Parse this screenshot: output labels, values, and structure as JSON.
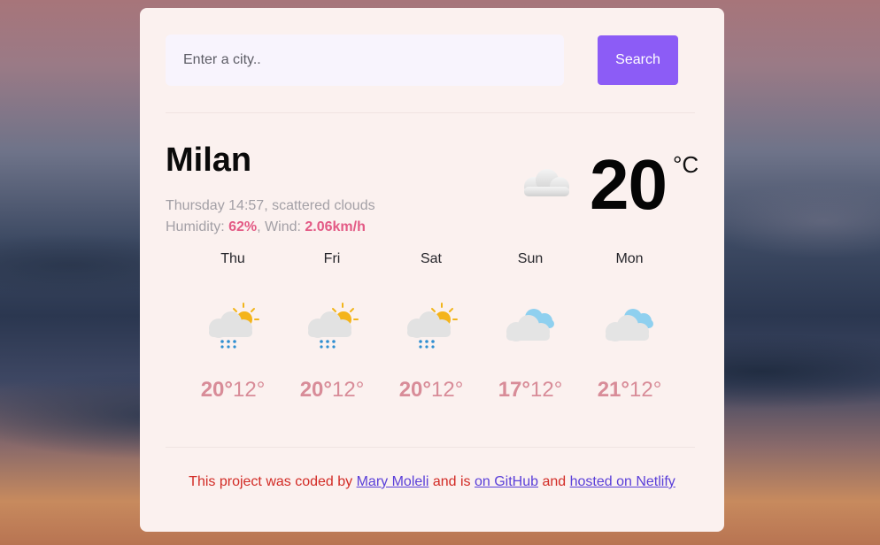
{
  "search": {
    "placeholder": "Enter a city..",
    "button_label": "Search"
  },
  "current": {
    "city": "Milan",
    "datetime": "Thursday 14:57",
    "description": "scattered clouds",
    "humidity_label": "Humidity: ",
    "humidity_value": "62%",
    "wind_label": ", Wind: ",
    "wind_value": "2.06km/h",
    "temperature": "20",
    "unit": "°C",
    "icon": "cloud-icon"
  },
  "forecast": [
    {
      "day": "Thu",
      "max": "20°",
      "min": "12°",
      "icon": "rain-sun-icon"
    },
    {
      "day": "Fri",
      "max": "20°",
      "min": "12°",
      "icon": "rain-sun-icon"
    },
    {
      "day": "Sat",
      "max": "20°",
      "min": "12°",
      "icon": "rain-sun-icon"
    },
    {
      "day": "Sun",
      "max": "17°",
      "min": "12°",
      "icon": "clouds-icon"
    },
    {
      "day": "Mon",
      "max": "21°",
      "min": "12°",
      "icon": "clouds-icon"
    }
  ],
  "footer": {
    "text_1": "This project was coded by ",
    "author_link": "Mary Moleli",
    "text_2": " and is ",
    "github_link": "on GitHub",
    "text_3": " and ",
    "netlify_link": "hosted on Netlify"
  },
  "colors": {
    "accent": "#8c5cf6",
    "highlight": "#e35a85",
    "forecast_temp": "#d88c98",
    "footer_text": "#d22b25",
    "card_bg": "#fbf1ef"
  }
}
